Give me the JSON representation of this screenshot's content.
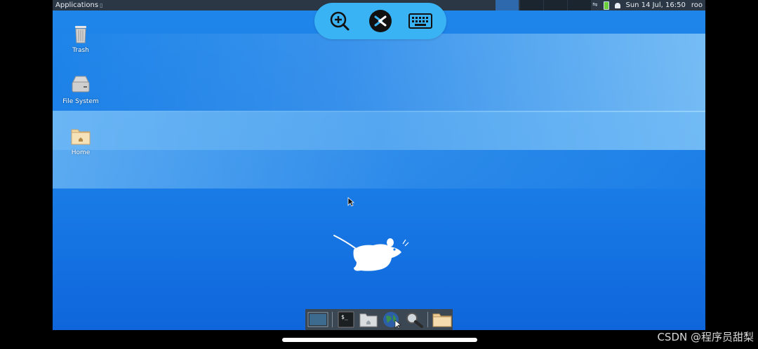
{
  "top_panel": {
    "applications_label": "Applications",
    "datetime": "Sun 14 Jul, 16:50",
    "user": "roo",
    "icons": [
      "network-arrows-icon",
      "battery-icon",
      "notification-bell-icon"
    ]
  },
  "remote_toolbar": {
    "buttons": [
      "zoom-in-icon",
      "remote-connect-icon",
      "keyboard-icon"
    ],
    "colors": {
      "bar": "#39b3f3",
      "connect_bg": "#111"
    }
  },
  "desktop": {
    "icons": [
      {
        "label": "Trash"
      },
      {
        "label": "File System"
      },
      {
        "label": "Home"
      }
    ],
    "colors": {
      "background": "#1a7de6"
    }
  },
  "dock": {
    "items": [
      "show-desktop-icon",
      "terminal-icon",
      "file-manager-icon",
      "web-browser-icon",
      "search-icon",
      "folder-icon"
    ]
  },
  "watermark": "CSDN @程序员甜梨"
}
